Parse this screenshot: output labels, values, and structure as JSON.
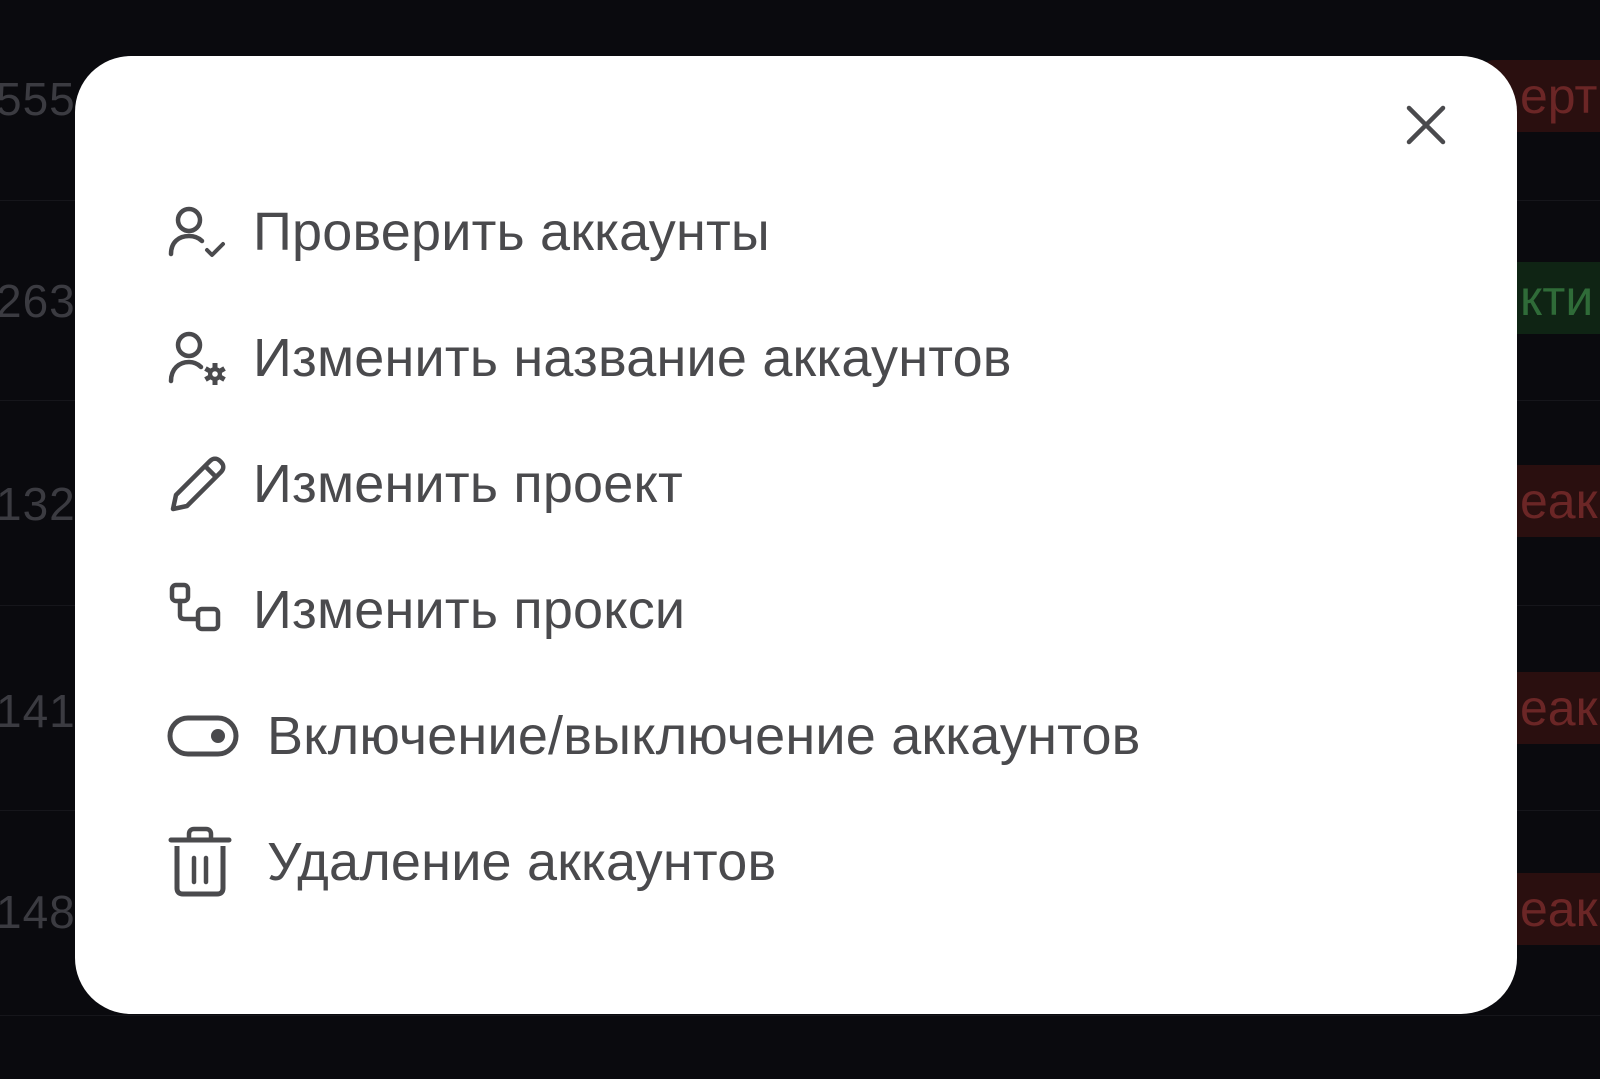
{
  "background": {
    "rows": [
      {
        "id": "555",
        "badge": "ерт",
        "status": "red"
      },
      {
        "id": "263",
        "badge": "кти",
        "status": "green"
      },
      {
        "id": "132",
        "badge": "еак",
        "status": "red"
      },
      {
        "id": "141",
        "badge": "еак",
        "status": "red"
      },
      {
        "id": "148",
        "badge": "еак",
        "status": "red"
      }
    ]
  },
  "modal": {
    "close_label": "×",
    "items": [
      {
        "label": "Проверить аккаунты",
        "icon": "user-check-icon"
      },
      {
        "label": "Изменить название аккаунтов",
        "icon": "user-gear-icon"
      },
      {
        "label": "Изменить проект",
        "icon": "pencil-icon"
      },
      {
        "label": "Изменить прокси",
        "icon": "proxy-nodes-icon"
      },
      {
        "label": "Включение/выключение аккаунтов",
        "icon": "toggle-icon"
      },
      {
        "label": "Удаление аккаунтов",
        "icon": "trash-icon"
      }
    ]
  },
  "colors": {
    "page_bg": "#0a0a0e",
    "modal_bg": "#ffffff",
    "text": "#4a4a4d",
    "icon": "#4a4a4d",
    "badge_red": "#6b2626",
    "badge_green": "#2f6b38"
  }
}
